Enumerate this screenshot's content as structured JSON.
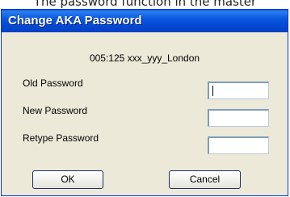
{
  "background_caption": "The password function in the master",
  "dialog": {
    "title": "Change AKA Password",
    "account": "005:125  xxx_yyy_London",
    "fields": [
      {
        "label": "Old Password",
        "value": ""
      },
      {
        "label": "New Password",
        "value": ""
      },
      {
        "label": "Retype Password",
        "value": ""
      }
    ],
    "buttons": {
      "ok_label": "OK",
      "cancel_label": "Cancel"
    }
  },
  "colors": {
    "titlebar": "#0349d4",
    "dialog_background": "#ece9d8",
    "input_border": "#7f9db9"
  }
}
